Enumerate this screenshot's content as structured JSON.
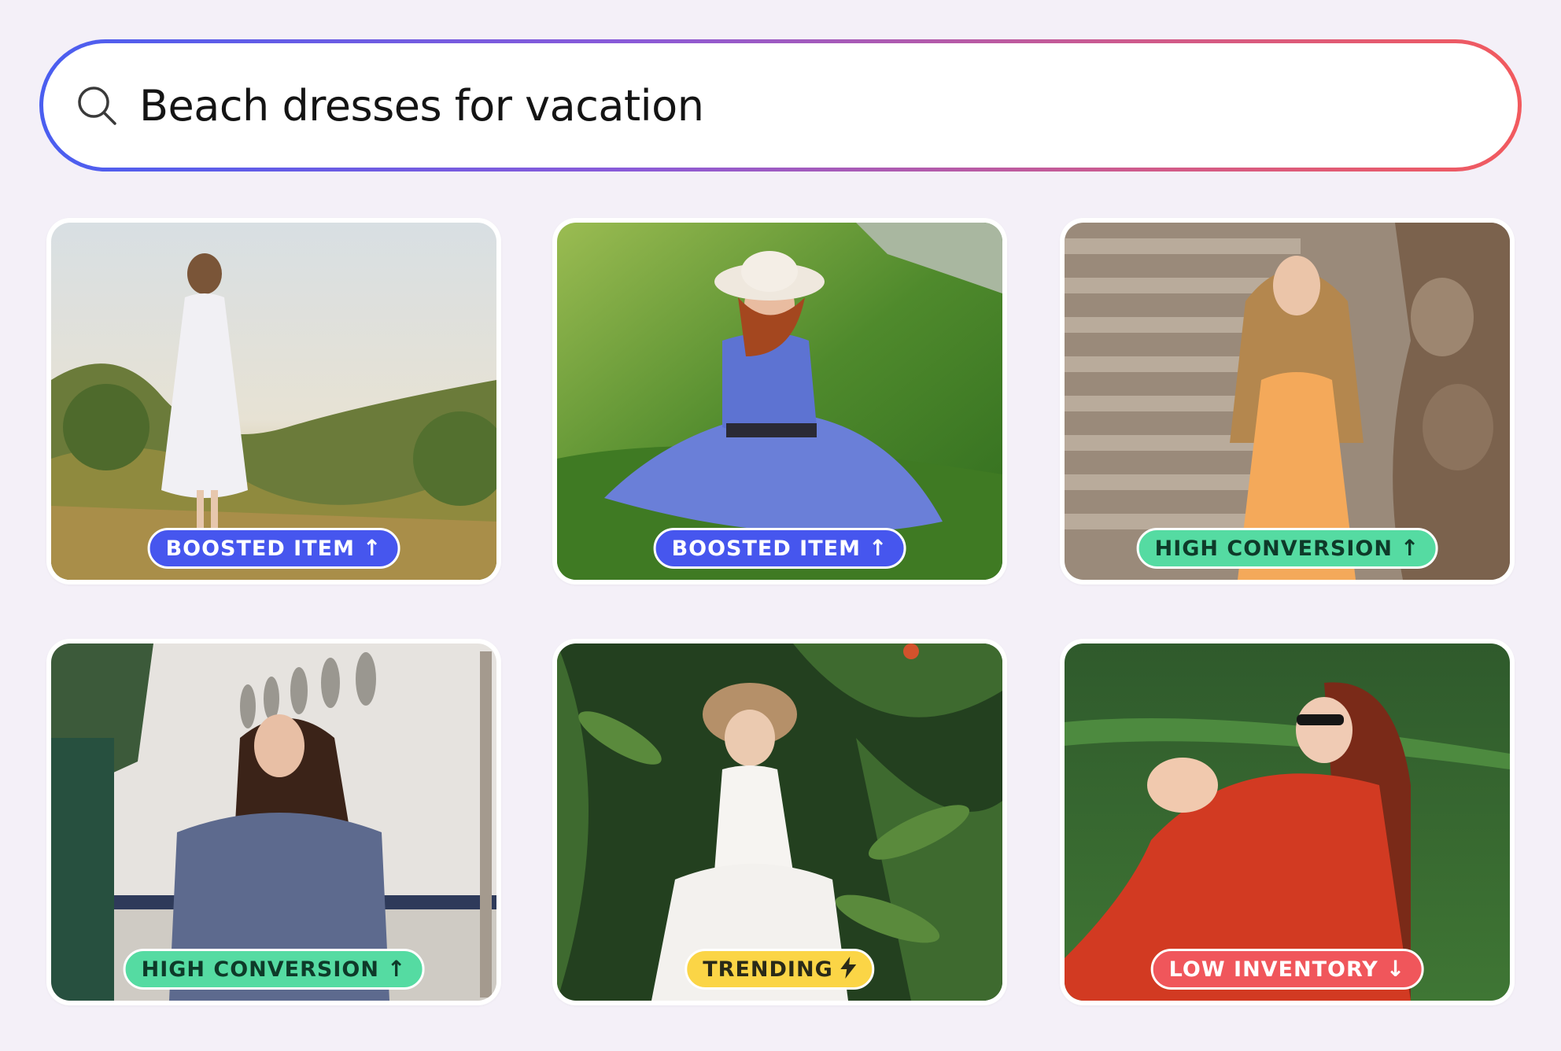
{
  "search": {
    "query": "Beach dresses for vacation",
    "icon": "search-icon"
  },
  "badge_colors": {
    "boosted": "#4656ee",
    "conversion": "#55dba2",
    "trending": "#fbd546",
    "inventory": "#f0565b"
  },
  "products": [
    {
      "badge_label": "BOOSTED ITEM",
      "badge_icon": "arrow-up-icon",
      "badge_type": "boosted",
      "photo_subject": "woman in white lace dress walking through sunlit field"
    },
    {
      "badge_label": "BOOSTED ITEM",
      "badge_icon": "arrow-up-icon",
      "badge_type": "boosted",
      "photo_subject": "woman in blue polka-dot dress and sun hat sitting on grass"
    },
    {
      "badge_label": "HIGH CONVERSION",
      "badge_icon": "arrow-up-icon",
      "badge_type": "conversion",
      "photo_subject": "woman in orange knit sundress by stone wall"
    },
    {
      "badge_label": "HIGH CONVERSION",
      "badge_icon": "arrow-up-icon",
      "badge_type": "conversion",
      "photo_subject": "woman in blue floral wrap dress by white wall"
    },
    {
      "badge_label": "TRENDING",
      "badge_icon": "lightning-icon",
      "badge_type": "trending",
      "photo_subject": "woman in white slip dress and straw hat among plants"
    },
    {
      "badge_label": "LOW INVENTORY",
      "badge_icon": "arrow-down-icon",
      "badge_type": "inventory",
      "photo_subject": "woman in red floral dress with sunglasses on lawn"
    }
  ]
}
